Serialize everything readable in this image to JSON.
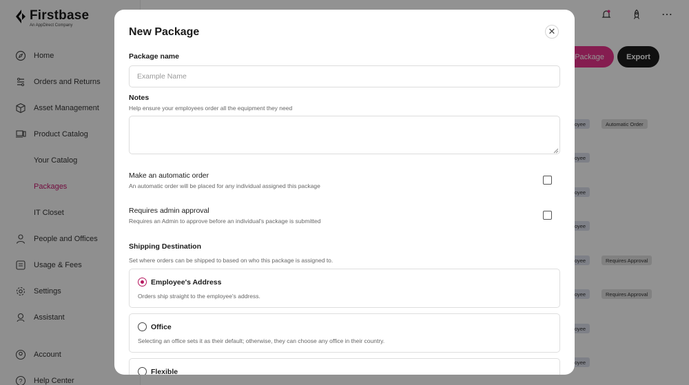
{
  "brand": {
    "name": "Firstbase",
    "sub": "An AppDirect Company"
  },
  "sidebar": {
    "items": [
      {
        "label": "Home",
        "icon": "compass-icon"
      },
      {
        "label": "Orders and Returns",
        "icon": "orders-icon"
      },
      {
        "label": "Asset Management",
        "icon": "box-icon"
      },
      {
        "label": "Product Catalog",
        "icon": "laptop-icon"
      },
      {
        "label": "Your Catalog",
        "sub": true
      },
      {
        "label": "Packages",
        "sub": true,
        "active": true
      },
      {
        "label": "IT Closet",
        "sub": true
      },
      {
        "label": "People and Offices",
        "icon": "person-icon"
      },
      {
        "label": "Usage & Fees",
        "icon": "receipt-icon"
      },
      {
        "label": "Settings",
        "icon": "gear-icon"
      },
      {
        "label": "Assistant",
        "icon": "assistant-icon"
      }
    ],
    "bottom": [
      {
        "label": "Account",
        "icon": "account-icon"
      },
      {
        "label": "Help Center",
        "icon": "help-icon"
      }
    ]
  },
  "header": {
    "new_package_label": "Package",
    "export_label": "Export",
    "icons": [
      "bell-icon",
      "rocket-icon",
      "more-icon"
    ]
  },
  "background_tags": {
    "employee": "ployee",
    "automatic_order": "Automatic Order",
    "requires_approval": "Requires Approval"
  },
  "modal": {
    "title": "New Package",
    "close_icon": "close-icon",
    "package_name": {
      "label": "Package name",
      "placeholder": "Example Name",
      "value": ""
    },
    "notes": {
      "label": "Notes",
      "help": "Help ensure your employees order all the equipment they need",
      "value": ""
    },
    "automatic_order": {
      "label": "Make an automatic order",
      "help": "An automatic order will be placed for any individual assigned this package",
      "checked": false
    },
    "admin_approval": {
      "label": "Requires admin approval",
      "help": "Requires an Admin to approve before an individual's package is submitted",
      "checked": false
    },
    "shipping": {
      "label": "Shipping Destination",
      "help": "Set where orders can be shipped to based on who this package is assigned to.",
      "options": [
        {
          "title": "Employee's Address",
          "desc": "Orders ship straight to the employee's address.",
          "selected": true
        },
        {
          "title": "Office",
          "desc": "Selecting an office sets it as their default; otherwise, they can choose any office in their country.",
          "selected": false
        },
        {
          "title": "Flexible",
          "desc": "",
          "selected": false
        }
      ]
    }
  },
  "colors": {
    "accent": "#e6338a",
    "radio_selected": "#b5185f",
    "dark_button": "#1d1d1d"
  }
}
